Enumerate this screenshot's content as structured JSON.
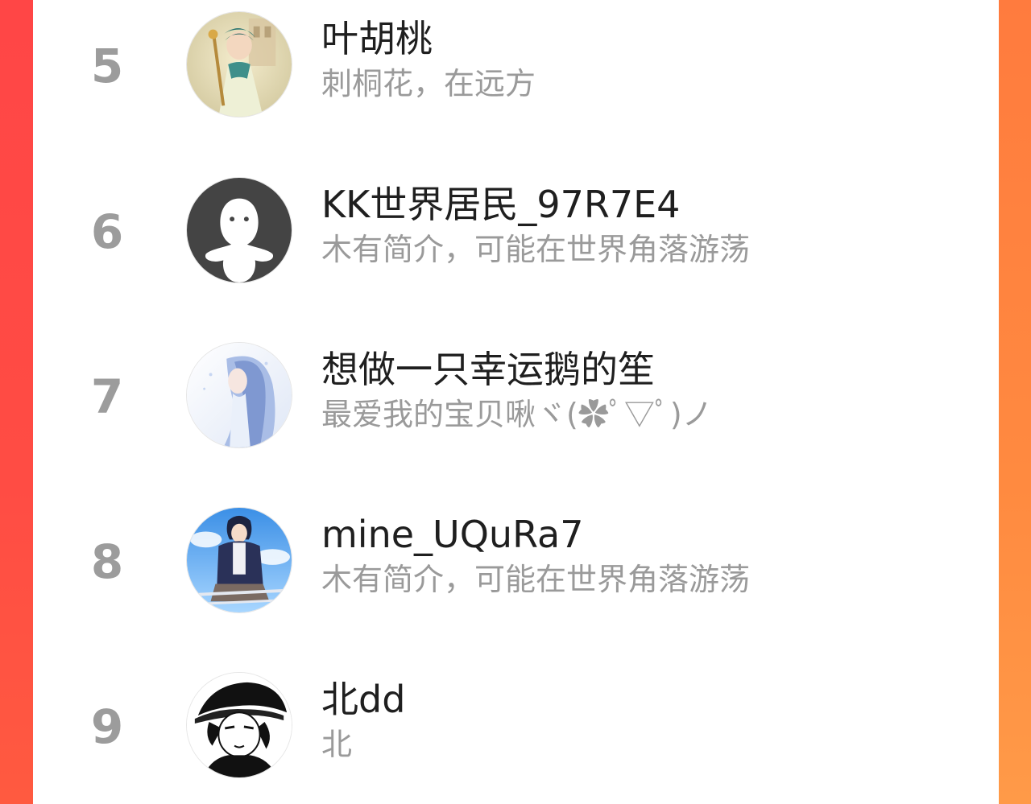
{
  "theme": {
    "accent_left": "#ff4545",
    "accent_right": "#ff8f42",
    "rank_color": "#9c9c9c",
    "name_color": "#1f1f1f",
    "bio_color": "#9a9a9a"
  },
  "ranking": [
    {
      "rank": "5",
      "name": "叶胡桃",
      "bio": "刺桐花，在远方",
      "avatar": "anime-boy-green-hair-avatar"
    },
    {
      "rank": "6",
      "name": "KK世界居民_97R7E4",
      "bio": "木有简介，可能在世界角落游荡",
      "avatar": "default-ghost-avatar"
    },
    {
      "rank": "7",
      "name": "想做一只幸运鹅的笙",
      "bio": "最爱我的宝贝啾ヾ(✿ﾟ▽ﾟ)ノ",
      "avatar": "anime-girl-blue-hair-avatar"
    },
    {
      "rank": "8",
      "name": "mine_UQuRa7",
      "bio": "木有简介，可能在世界角落游荡",
      "avatar": "anime-boy-bicycle-avatar"
    },
    {
      "rank": "9",
      "name": "北dd",
      "bio": "北",
      "avatar": "anime-boy-cap-sketch-avatar"
    }
  ]
}
